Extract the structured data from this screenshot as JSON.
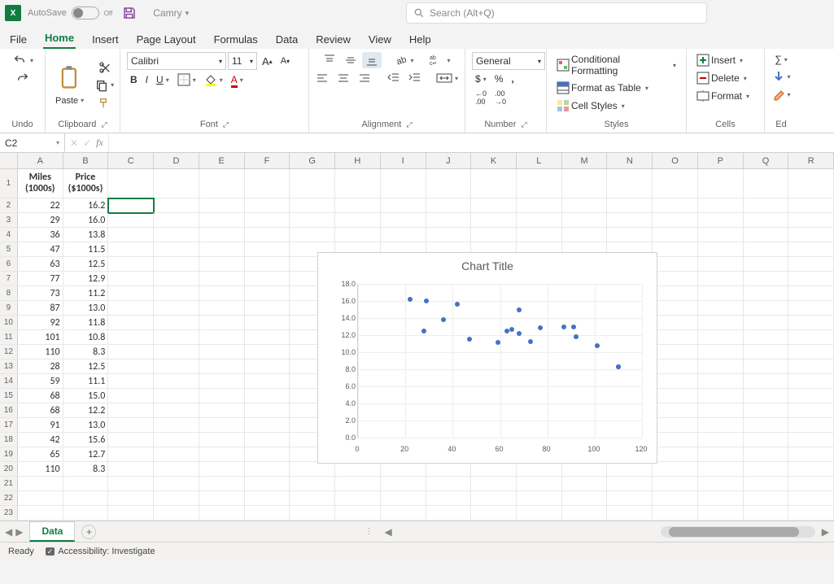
{
  "titlebar": {
    "autosave_label": "AutoSave",
    "autosave_state": "Off",
    "doc_name": "Camry",
    "search_placeholder": "Search (Alt+Q)"
  },
  "tabs": {
    "file": "File",
    "home": "Home",
    "insert": "Insert",
    "page_layout": "Page Layout",
    "formulas": "Formulas",
    "data": "Data",
    "review": "Review",
    "view": "View",
    "help": "Help"
  },
  "ribbon": {
    "undo": "Undo",
    "clipboard": "Clipboard",
    "paste": "Paste",
    "font_group": "Font",
    "font_name": "Calibri",
    "font_size": "11",
    "alignment": "Alignment",
    "number": "Number",
    "number_format": "General",
    "styles": "Styles",
    "cf": "Conditional Formatting",
    "fat": "Format as Table",
    "cs": "Cell Styles",
    "cells": "Cells",
    "insert_btn": "Insert",
    "delete_btn": "Delete",
    "format_btn": "Format",
    "editing": "Ed"
  },
  "formula": {
    "cell_ref": "C2",
    "fx": "fx"
  },
  "columns": [
    "A",
    "B",
    "C",
    "D",
    "E",
    "F",
    "G",
    "H",
    "I",
    "J",
    "K",
    "L",
    "M",
    "N",
    "O",
    "P",
    "Q",
    "R"
  ],
  "headers": {
    "a": "Miles (1000s)",
    "b": "Price ($1000s)"
  },
  "rows": [
    {
      "a": "22",
      "b": "16.2"
    },
    {
      "a": "29",
      "b": "16.0"
    },
    {
      "a": "36",
      "b": "13.8"
    },
    {
      "a": "47",
      "b": "11.5"
    },
    {
      "a": "63",
      "b": "12.5"
    },
    {
      "a": "77",
      "b": "12.9"
    },
    {
      "a": "73",
      "b": "11.2"
    },
    {
      "a": "87",
      "b": "13.0"
    },
    {
      "a": "92",
      "b": "11.8"
    },
    {
      "a": "101",
      "b": "10.8"
    },
    {
      "a": "110",
      "b": "8.3"
    },
    {
      "a": "28",
      "b": "12.5"
    },
    {
      "a": "59",
      "b": "11.1"
    },
    {
      "a": "68",
      "b": "15.0"
    },
    {
      "a": "68",
      "b": "12.2"
    },
    {
      "a": "91",
      "b": "13.0"
    },
    {
      "a": "42",
      "b": "15.6"
    },
    {
      "a": "65",
      "b": "12.7"
    },
    {
      "a": "110",
      "b": "8.3"
    }
  ],
  "sheet": {
    "name": "Data"
  },
  "status": {
    "ready": "Ready",
    "accessibility": "Accessibility: Investigate"
  },
  "chart_data": {
    "type": "scatter",
    "title": "Chart Title",
    "xlabel": "",
    "ylabel": "",
    "xlim": [
      0,
      120
    ],
    "ylim": [
      0,
      18
    ],
    "x_ticks": [
      0,
      20,
      40,
      60,
      80,
      100,
      120
    ],
    "y_ticks": [
      0.0,
      2.0,
      4.0,
      6.0,
      8.0,
      10.0,
      12.0,
      14.0,
      16.0,
      18.0
    ],
    "series": [
      {
        "name": "Price",
        "x": [
          22,
          29,
          36,
          47,
          63,
          77,
          73,
          87,
          92,
          101,
          110,
          28,
          59,
          68,
          68,
          91,
          42,
          65,
          110
        ],
        "y": [
          16.2,
          16.0,
          13.8,
          11.5,
          12.5,
          12.9,
          11.2,
          13.0,
          11.8,
          10.8,
          8.3,
          12.5,
          11.1,
          15.0,
          12.2,
          13.0,
          15.6,
          12.7,
          8.3
        ]
      }
    ]
  }
}
